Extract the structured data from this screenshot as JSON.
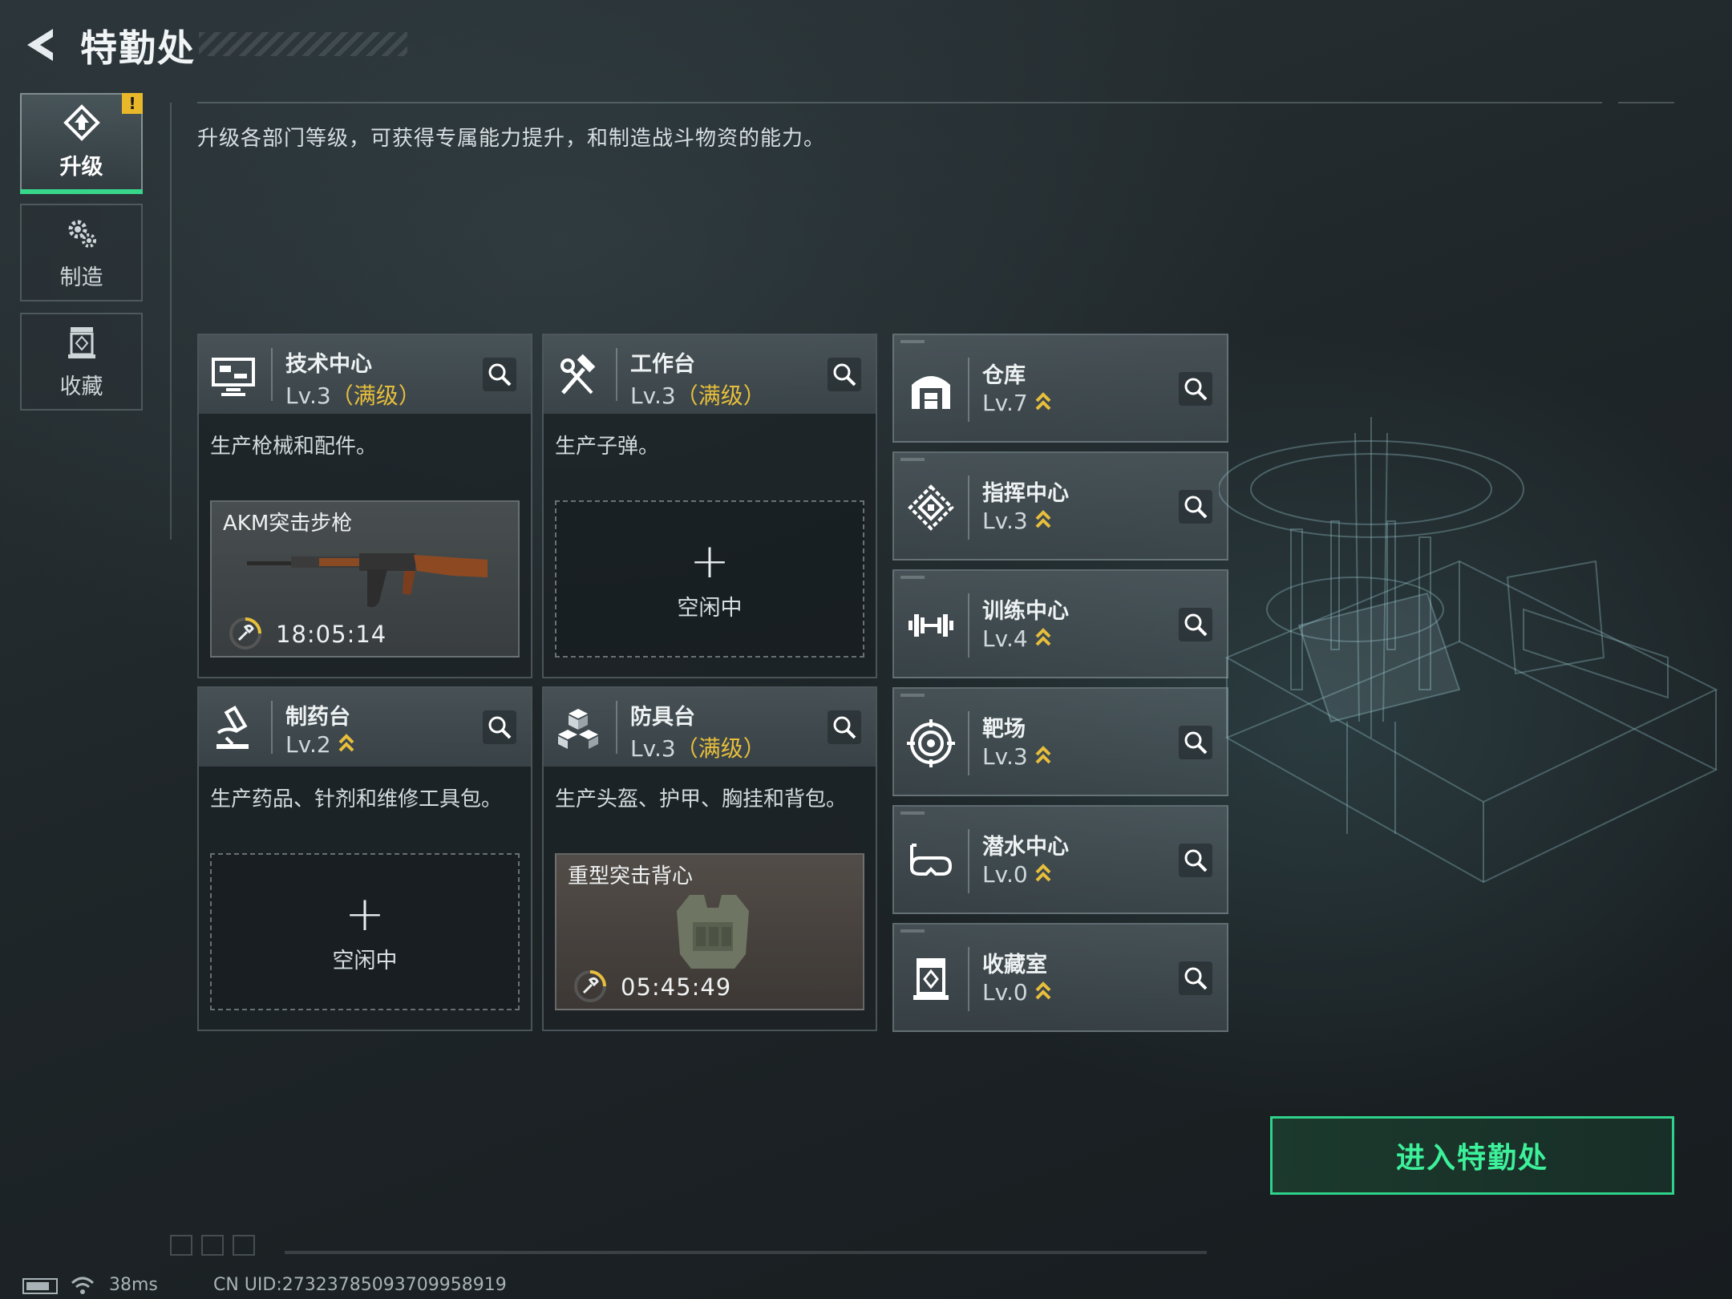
{
  "header": {
    "title": "特勤处"
  },
  "tabs": [
    {
      "label": "升级",
      "icon": "upgrade-icon",
      "active": true,
      "badge": "!"
    },
    {
      "label": "制造",
      "icon": "gears-icon",
      "active": false
    },
    {
      "label": "收藏",
      "icon": "collection-icon",
      "active": false
    }
  ],
  "description": "升级各部门等级，可获得专属能力提升，和制造战斗物资的能力。",
  "departments": [
    {
      "name": "技术中心",
      "level": "Lv.3",
      "max_tag": "（满级）",
      "desc": "生产枪械和配件。",
      "icon": "monitor-icon",
      "slot": {
        "state": "producing",
        "item": "AKM突击步枪",
        "timer": "18:05:14"
      }
    },
    {
      "name": "工作台",
      "level": "Lv.3",
      "max_tag": "（满级）",
      "desc": "生产子弹。",
      "icon": "hammer-wrench-icon",
      "slot": {
        "state": "idle",
        "plus": "+",
        "label": "空闲中"
      }
    },
    {
      "name": "制药台",
      "level": "Lv.2",
      "max_tag": "",
      "desc": "生产药品、针剂和维修工具包。",
      "icon": "microscope-icon",
      "slot": {
        "state": "idle",
        "plus": "+",
        "label": "空闲中"
      }
    },
    {
      "name": "防具台",
      "level": "Lv.3",
      "max_tag": "（满级）",
      "desc": "生产头盔、护甲、胸挂和背包。",
      "icon": "cubes-icon",
      "slot": {
        "state": "producing",
        "item": "重型突击背心",
        "timer": "05:45:49"
      }
    }
  ],
  "facilities": [
    {
      "name": "仓库",
      "level": "Lv.7",
      "icon": "warehouse-icon"
    },
    {
      "name": "指挥中心",
      "level": "Lv.3",
      "icon": "command-icon"
    },
    {
      "name": "训练中心",
      "level": "Lv.4",
      "icon": "dumbbell-icon"
    },
    {
      "name": "靶场",
      "level": "Lv.3",
      "icon": "target-icon"
    },
    {
      "name": "潜水中心",
      "level": "Lv.0",
      "icon": "diving-mask-icon"
    },
    {
      "name": "收藏室",
      "level": "Lv.0",
      "icon": "collection-room-icon"
    }
  ],
  "enter_button": {
    "label": "进入特勤处"
  },
  "status_bar": {
    "ping": "38ms",
    "uid": "CN UID:27323785093709958919"
  },
  "colors": {
    "accent_green": "#2fd28a",
    "max_level_gold": "#e8bf3c",
    "upgrade_chevron": "#e8bf3c"
  }
}
